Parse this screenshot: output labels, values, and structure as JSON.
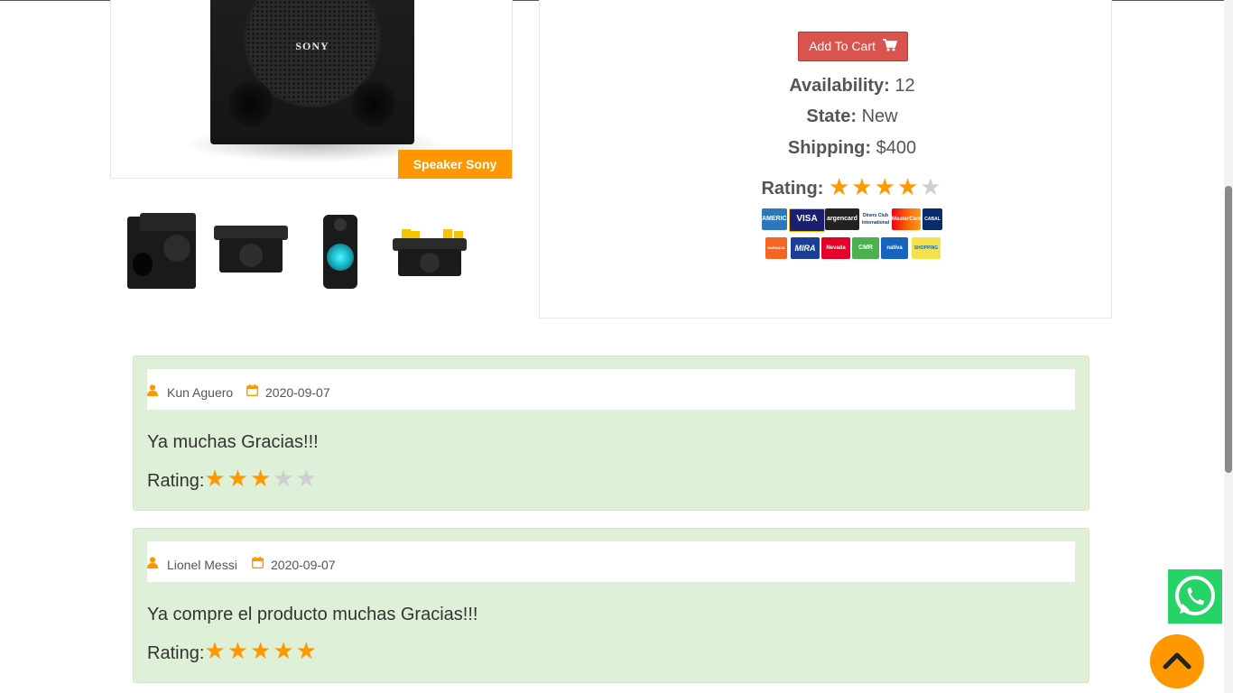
{
  "product": {
    "image_caption": "Speaker Sony",
    "brand_logo_text": "SONY",
    "add_to_cart_label": "Add To Cart",
    "availability_label": "Availability:",
    "availability_value": "12",
    "state_label": "State:",
    "state_value": "New",
    "shipping_label": "Shipping:",
    "shipping_value": "$400",
    "rating_label": "Rating:",
    "rating_stars": 4,
    "rating_max": 5
  },
  "payment_methods": [
    "AMERICAN EXPRESS",
    "VISA",
    "argencard",
    "Diners Club International",
    "MasterCard",
    "CABAL",
    "NARANJA",
    "MIRA",
    "Nevada",
    "CMR",
    "nativa",
    "SHOPPING"
  ],
  "reviews": [
    {
      "author": "Kun Aguero",
      "date": "2020-09-07",
      "text": "Ya muchas Gracias!!!",
      "rating_label": "Rating:",
      "rating": 3,
      "rating_max": 5
    },
    {
      "author": "Lionel Messi",
      "date": "2020-09-07",
      "text": "Ya compre el producto muchas Gracias!!!",
      "rating_label": "Rating:",
      "rating": 5,
      "rating_max": 5
    }
  ],
  "colors": {
    "accent": "#ff9800",
    "cart_button": "#d9534f",
    "review_bg": "#dff0d8",
    "whatsapp": "#25d366",
    "star_off": "#cfcfcf"
  },
  "icons": [
    "cart-icon",
    "user-icon",
    "calendar-icon",
    "whatsapp-icon",
    "chevron-up-icon"
  ]
}
